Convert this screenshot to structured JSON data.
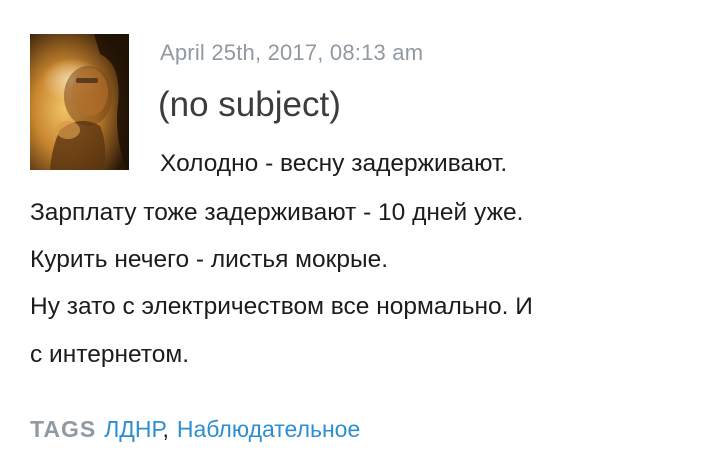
{
  "post": {
    "date": "April 25th, 2017, 08:13 am",
    "subject": "(no subject)",
    "body_lines": [
      "Холодно - весну задерживают.",
      "Зарплату тоже задерживают - 10 дней уже.",
      "Курить нечего - листья мокрые.",
      "Ну зато с электричеством все нормально. И",
      "с интернетом."
    ],
    "tags_label": "TAGS",
    "tags": [
      {
        "label": "ЛДНР"
      },
      {
        "label": "Наблюдательное"
      }
    ],
    "tag_separator": ",",
    "avatar_icon": "user-avatar-photo"
  },
  "colors": {
    "meta_text": "#8f9aa3",
    "link": "#2e8fd0",
    "body_text": "#1c1c1c"
  }
}
